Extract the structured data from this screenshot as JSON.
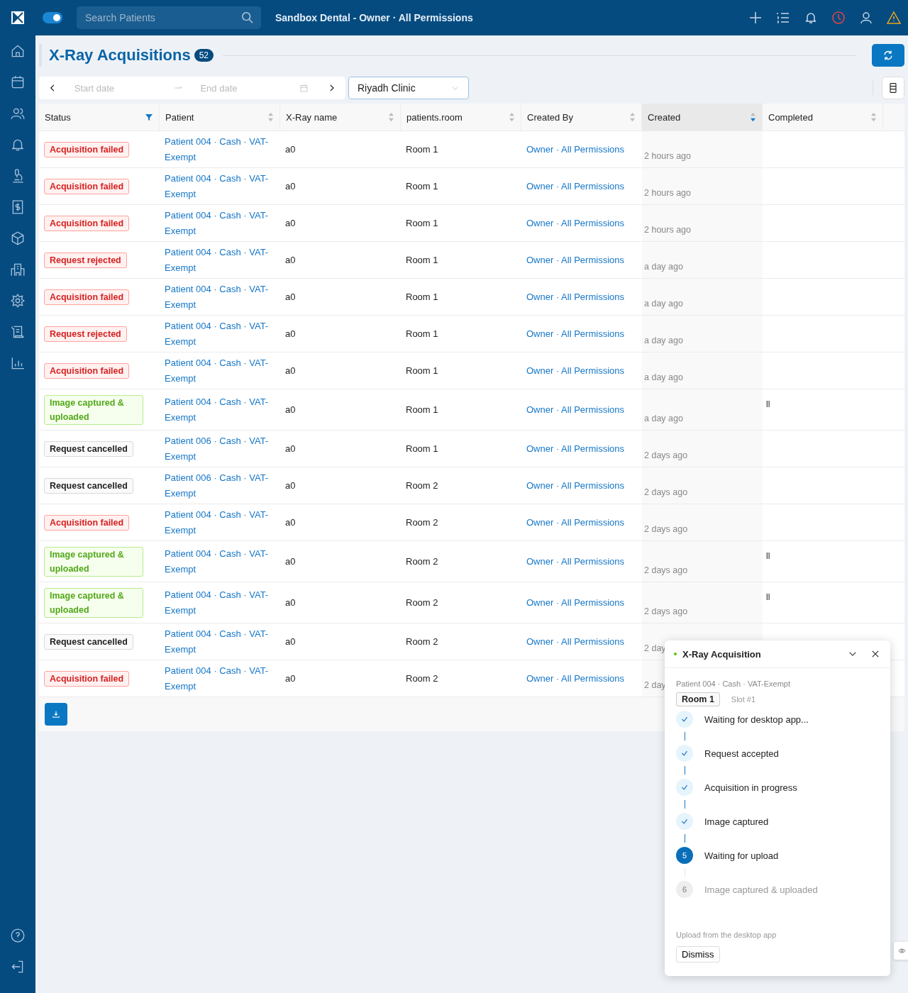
{
  "topbar": {
    "toggle": {
      "on": true
    },
    "search": {
      "placeholder": "Search Patients"
    },
    "title": "Sandbox Dental - Owner · All Permissions"
  },
  "page": {
    "title": "X-Ray Acquisitions",
    "count": "52"
  },
  "filters": {
    "start_date": {
      "placeholder": "Start date"
    },
    "end_date": {
      "placeholder": "End date"
    },
    "clinic": "Riyadh Clinic"
  },
  "table": {
    "columns": [
      {
        "label": "Status",
        "kind": "filter",
        "active": true
      },
      {
        "label": "Patient",
        "kind": "sort",
        "active": false
      },
      {
        "label": "X-Ray name",
        "kind": "sort",
        "active": false
      },
      {
        "label": "patients.room",
        "kind": "sort",
        "active": false
      },
      {
        "label": "Created By",
        "kind": "sort",
        "active": false
      },
      {
        "label": "Created",
        "kind": "sort",
        "active": true
      },
      {
        "label": "Completed",
        "kind": "sort",
        "active": false
      }
    ],
    "rows": [
      {
        "status": "Acquisition failed",
        "kind": "error",
        "patient": "Patient 004 · Cash · VAT-Exempt",
        "xray": "a0",
        "room": "Room 1",
        "created_by": "Owner · All Permissions",
        "created": "2 hours ago"
      },
      {
        "status": "Acquisition failed",
        "kind": "error",
        "patient": "Patient 004 · Cash · VAT-Exempt",
        "xray": "a0",
        "room": "Room 1",
        "created_by": "Owner · All Permissions",
        "created": "2 hours ago"
      },
      {
        "status": "Acquisition failed",
        "kind": "error",
        "patient": "Patient 004 · Cash · VAT-Exempt",
        "xray": "a0",
        "room": "Room 1",
        "created_by": "Owner · All Permissions",
        "created": "2 hours ago"
      },
      {
        "status": "Request rejected",
        "kind": "error",
        "patient": "Patient 004 · Cash · VAT-Exempt",
        "xray": "a0",
        "room": "Room 1",
        "created_by": "Owner · All Permissions",
        "created": "a day ago"
      },
      {
        "status": "Acquisition failed",
        "kind": "error",
        "patient": "Patient 004 · Cash · VAT-Exempt",
        "xray": "a0",
        "room": "Room 1",
        "created_by": "Owner · All Permissions",
        "created": "a day ago"
      },
      {
        "status": "Request rejected",
        "kind": "error",
        "patient": "Patient 004 · Cash · VAT-Exempt",
        "xray": "a0",
        "room": "Room 1",
        "created_by": "Owner · All Permissions",
        "created": "a day ago"
      },
      {
        "status": "Acquisition failed",
        "kind": "error",
        "patient": "Patient 004 · Cash · VAT-Exempt",
        "xray": "a0",
        "room": "Room 1",
        "created_by": "Owner · All Permissions",
        "created": "a day ago"
      },
      {
        "status": "Image captured & uploaded",
        "kind": "success",
        "patient": "Patient 004 · Cash · VAT-Exempt",
        "xray": "a0",
        "room": "Room 1",
        "created_by": "Owner · All Permissions",
        "created": "a day ago",
        "completed": "ll"
      },
      {
        "status": "Request cancelled",
        "kind": "neutral",
        "patient": "Patient 006 · Cash · VAT-Exempt",
        "xray": "a0",
        "room": "Room 1",
        "created_by": "Owner · All Permissions",
        "created": "2 days ago"
      },
      {
        "status": "Request cancelled",
        "kind": "neutral",
        "patient": "Patient 006 · Cash · VAT-Exempt",
        "xray": "a0",
        "room": "Room 2",
        "created_by": "Owner · All Permissions",
        "created": "2 days ago"
      },
      {
        "status": "Acquisition failed",
        "kind": "error",
        "patient": "Patient 004 · Cash · VAT-Exempt",
        "xray": "a0",
        "room": "Room 2",
        "created_by": "Owner · All Permissions",
        "created": "2 days ago"
      },
      {
        "status": "Image captured & uploaded",
        "kind": "success",
        "patient": "Patient 004 · Cash · VAT-Exempt",
        "xray": "a0",
        "room": "Room 2",
        "created_by": "Owner · All Permissions",
        "created": "2 days ago",
        "completed": "ll"
      },
      {
        "status": "Image captured & uploaded",
        "kind": "success",
        "patient": "Patient 004 · Cash · VAT-Exempt",
        "xray": "a0",
        "room": "Room 2",
        "created_by": "Owner · All Permissions",
        "created": "2 days ago",
        "completed": "ll"
      },
      {
        "status": "Request cancelled",
        "kind": "neutral",
        "patient": "Patient 004 · Cash · VAT-Exempt",
        "xray": "a0",
        "room": "Room 2",
        "created_by": "Owner · All Permissions",
        "created": "2 day"
      },
      {
        "status": "Acquisition failed",
        "kind": "error",
        "patient": "Patient 004 · Cash · VAT-Exempt",
        "xray": "a0",
        "room": "Room 2",
        "created_by": "Owner · All Permissions",
        "created": "2 day"
      }
    ]
  },
  "panel": {
    "title": "X-Ray Acquisition",
    "patient": "Patient 004 · Cash · VAT-Exempt",
    "room": "Room 1",
    "slot": "Slot #1",
    "steps": [
      {
        "label": "Waiting for desktop app...",
        "kind": "done"
      },
      {
        "label": "Request accepted",
        "kind": "done"
      },
      {
        "label": "Acquisition in progress",
        "kind": "done"
      },
      {
        "label": "Image captured",
        "kind": "done"
      },
      {
        "label": "Waiting for upload",
        "kind": "current",
        "number": "5"
      },
      {
        "label": "Image captured & uploaded",
        "kind": "pending",
        "number": "6"
      }
    ],
    "note": "Upload from the desktop app",
    "dismiss": "Dismiss"
  }
}
